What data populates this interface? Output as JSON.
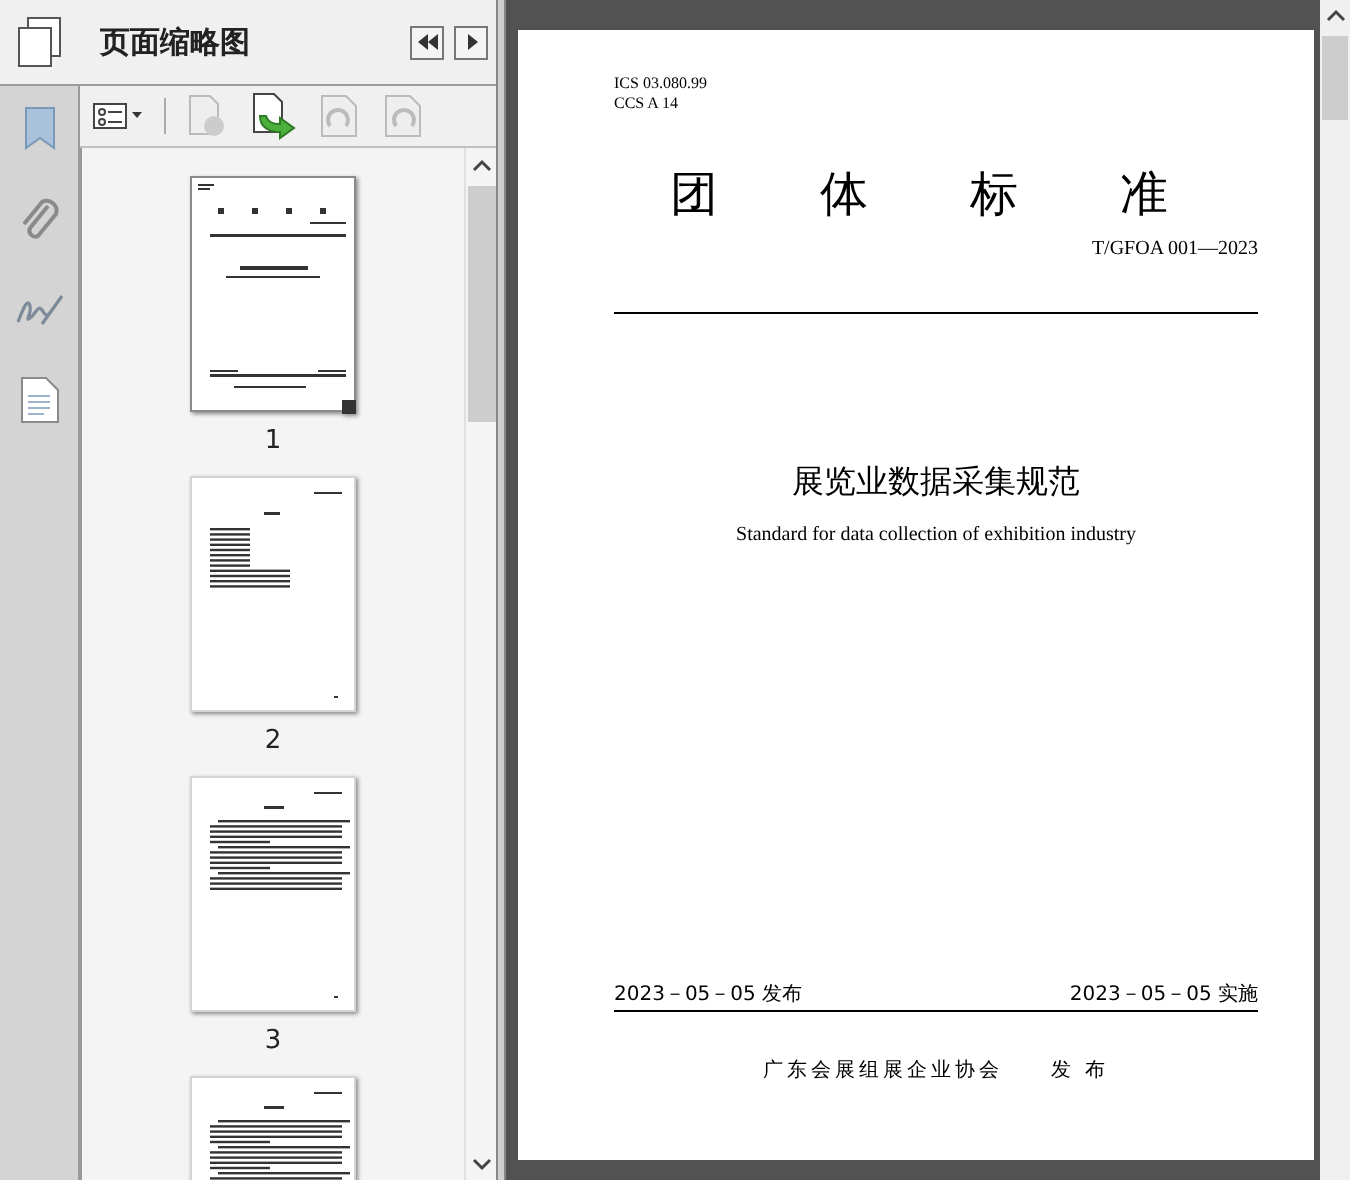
{
  "panel": {
    "title": "页面缩略图"
  },
  "thumbnails": [
    {
      "kind": "cover",
      "label": "1",
      "selected": true
    },
    {
      "kind": "toc",
      "label": "2",
      "selected": false
    },
    {
      "kind": "text",
      "label": "3",
      "selected": false
    },
    {
      "kind": "text",
      "selected": false
    }
  ],
  "page": {
    "ics": "ICS 03.080.99",
    "ccs": "CCS A 14",
    "heading": "团体标准",
    "code": "T/GFOA 001—2023",
    "title": "展览业数据采集规范",
    "subtitle": "Standard for data collection of exhibition industry",
    "issued": "2023－05－05 发布",
    "effective": "2023－05－05 实施",
    "publisher": "广东会展组展企业协会",
    "publish_word": "发 布"
  }
}
